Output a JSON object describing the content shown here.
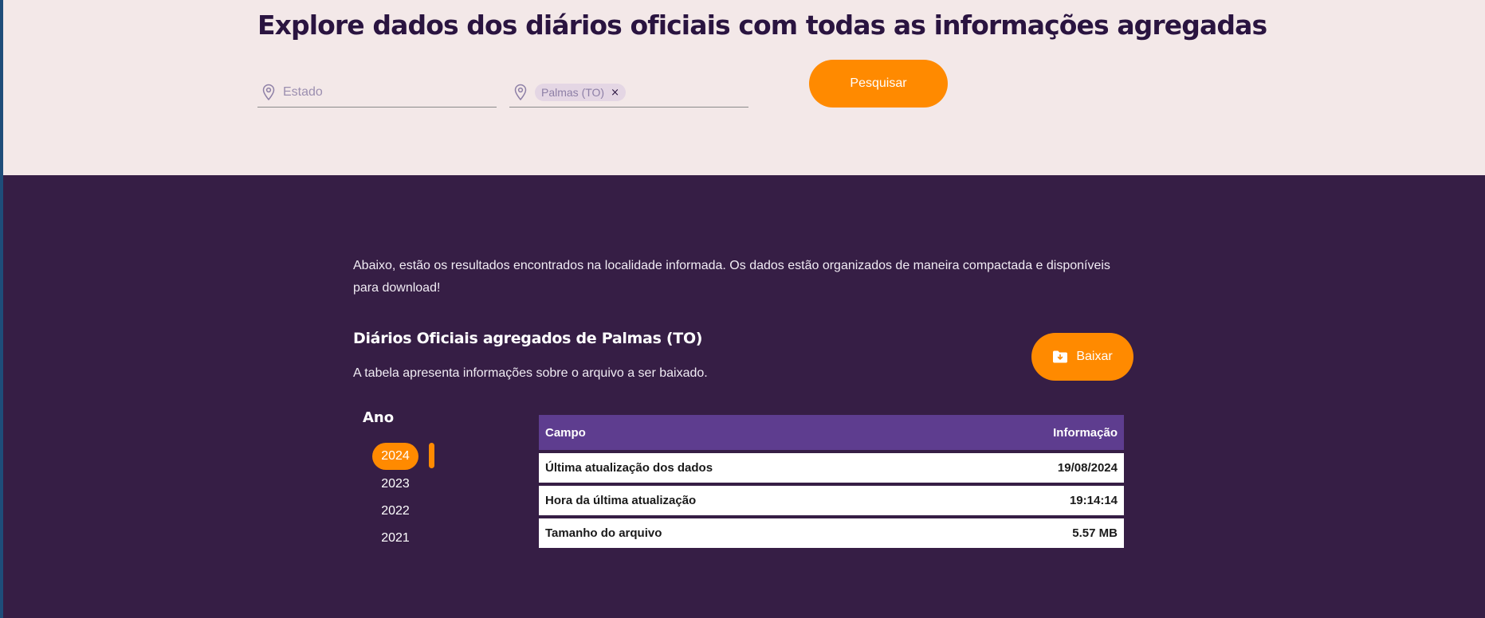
{
  "header": {
    "title": "Explore dados dos diários oficiais com todas as informações agregadas"
  },
  "search": {
    "state_placeholder": "Estado",
    "selected_city_chip": "Palmas (TO)",
    "chip_remove": "×",
    "submit_label": "Pesquisar"
  },
  "results": {
    "intro": "Abaixo, estão os resultados encontrados na localidade informada. Os dados estão organizados de maneira compactada e disponíveis para download!",
    "title": "Diários Oficiais agregados de Palmas (TO)",
    "subtitle": "A tabela apresenta informações sobre o arquivo a ser baixado.",
    "download_label": "Baixar"
  },
  "years": {
    "heading": "Ano",
    "selected": "2024",
    "items": [
      "2024",
      "2023",
      "2022",
      "2021"
    ]
  },
  "table": {
    "headers": [
      "Campo",
      "Informação"
    ],
    "rows": [
      [
        "Última atualização dos dados",
        "19/08/2024"
      ],
      [
        "Hora da última atualização",
        "19:14:14"
      ],
      [
        "Tamanho do arquivo",
        "5.57 MB"
      ]
    ]
  },
  "colors": {
    "accent": "#ff8a00",
    "background_dark": "#361e45",
    "background_light": "#f3e8e8",
    "table_header": "#5e3d8f",
    "title_text": "#2a1440"
  },
  "icons": {
    "field_icon": "location-pin-icon",
    "download_icon": "folder-download-icon"
  }
}
